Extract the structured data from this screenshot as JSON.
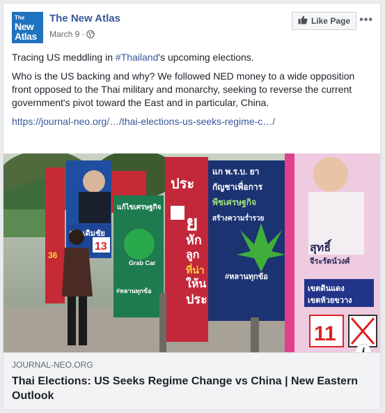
{
  "post": {
    "page_name": "The New Atlas",
    "date": "March 9",
    "separator": "·",
    "like_button": "Like Page",
    "more": "•••",
    "avatar": {
      "line1": "The",
      "line2": "New",
      "line3": "Atlas"
    },
    "text": {
      "p1_before": "Tracing US meddling in ",
      "p1_hashtag": "#Thailand",
      "p1_after": "'s upcoming elections.",
      "p2": "Who is the US backing and why? We followed NED money to a wide opposition front opposed to the Thai military and monarchy, seeking to reverse the current government's pivot toward the East and in particular, China.",
      "url": "https://journal-neo.org/…/thai-elections-us-seeks-regime-c…/"
    },
    "link_preview": {
      "domain": "JOURNAL-NEO.ORG",
      "title": "Thai Elections: US Seeks Regime Change vs China | New Eastern Outlook",
      "info": "i"
    },
    "photo": {
      "signs": [
        "ประเดิมชัย",
        "13",
        "แก้ไขเศรษฐกิจ",
        "Grab Car",
        "#หลานทุกข้อ",
        "ประ",
        "ย",
        "หัก",
        "ลูก",
        "ที่น่า",
        "ให้น",
        "ประ",
        "แก พ.ร.บ. ยา",
        "กัญชาเพื่อการ",
        "พืชเศรษฐกิจ",
        "สร้างความร่ำรวย",
        "#หลานทุกข้อ",
        "สุทธิ์",
        "จีระรัตน์วงศ์",
        "เขตดินแดง",
        "เขตห้วยขวาง",
        "11"
      ]
    },
    "colors": {
      "brand": "#1e73be",
      "link": "#365899"
    }
  }
}
